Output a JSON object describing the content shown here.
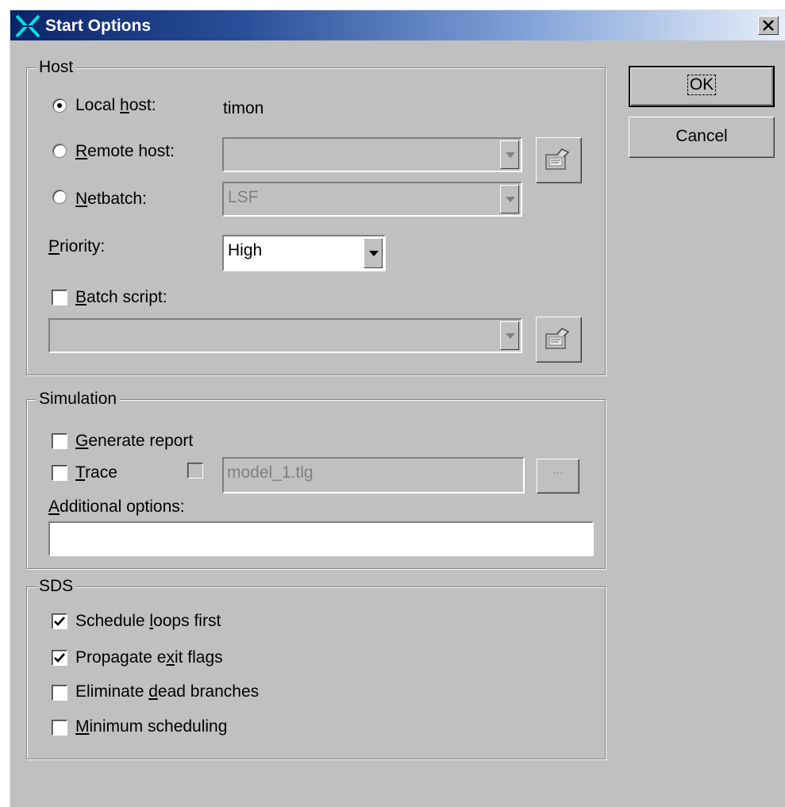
{
  "window": {
    "title": "Start Options",
    "accent_color": "#0a246a"
  },
  "buttons": {
    "ok": "OK",
    "cancel": "Cancel",
    "close_icon": "close-x-icon",
    "browse_icon": "folder-properties-icon",
    "ellipsis": "..."
  },
  "host": {
    "legend": "Host",
    "local_host": {
      "label_pre": "Local ",
      "label_key": "h",
      "label_post": "ost:",
      "selected": true,
      "value": "timon"
    },
    "remote_host": {
      "label_pre": "",
      "label_key": "R",
      "label_post": "emote host:",
      "selected": false,
      "value": ""
    },
    "netbatch": {
      "label_pre": "",
      "label_key": "N",
      "label_post": "etbatch:",
      "selected": false,
      "value": "LSF"
    },
    "priority": {
      "label_pre": "",
      "label_key": "P",
      "label_post": "riority:",
      "value": "High"
    },
    "batch_script": {
      "label_pre": "",
      "label_key": "B",
      "label_post": "atch script:",
      "checked": false,
      "value": ""
    }
  },
  "simulation": {
    "legend": "Simulation",
    "generate_report": {
      "label_pre": "",
      "label_key": "G",
      "label_post": "enerate report",
      "checked": false
    },
    "trace": {
      "label_pre": "",
      "label_key": "T",
      "label_post": "race",
      "checked": false,
      "file_checked": false,
      "file": "model_1.tlg"
    },
    "additional_options": {
      "label_pre": "",
      "label_key": "A",
      "label_post": "dditional options:",
      "value": ""
    }
  },
  "sds": {
    "legend": "SDS",
    "options": [
      {
        "label_pre": "Schedule ",
        "label_key": "l",
        "label_post": "oops first",
        "checked": true
      },
      {
        "label_pre": "Propagate e",
        "label_key": "x",
        "label_post": "it flags",
        "checked": true
      },
      {
        "label_pre": "Eliminate ",
        "label_key": "d",
        "label_post": "ead branches",
        "checked": false
      },
      {
        "label_pre": "",
        "label_key": "M",
        "label_post": "inimum scheduling",
        "checked": false
      }
    ]
  }
}
